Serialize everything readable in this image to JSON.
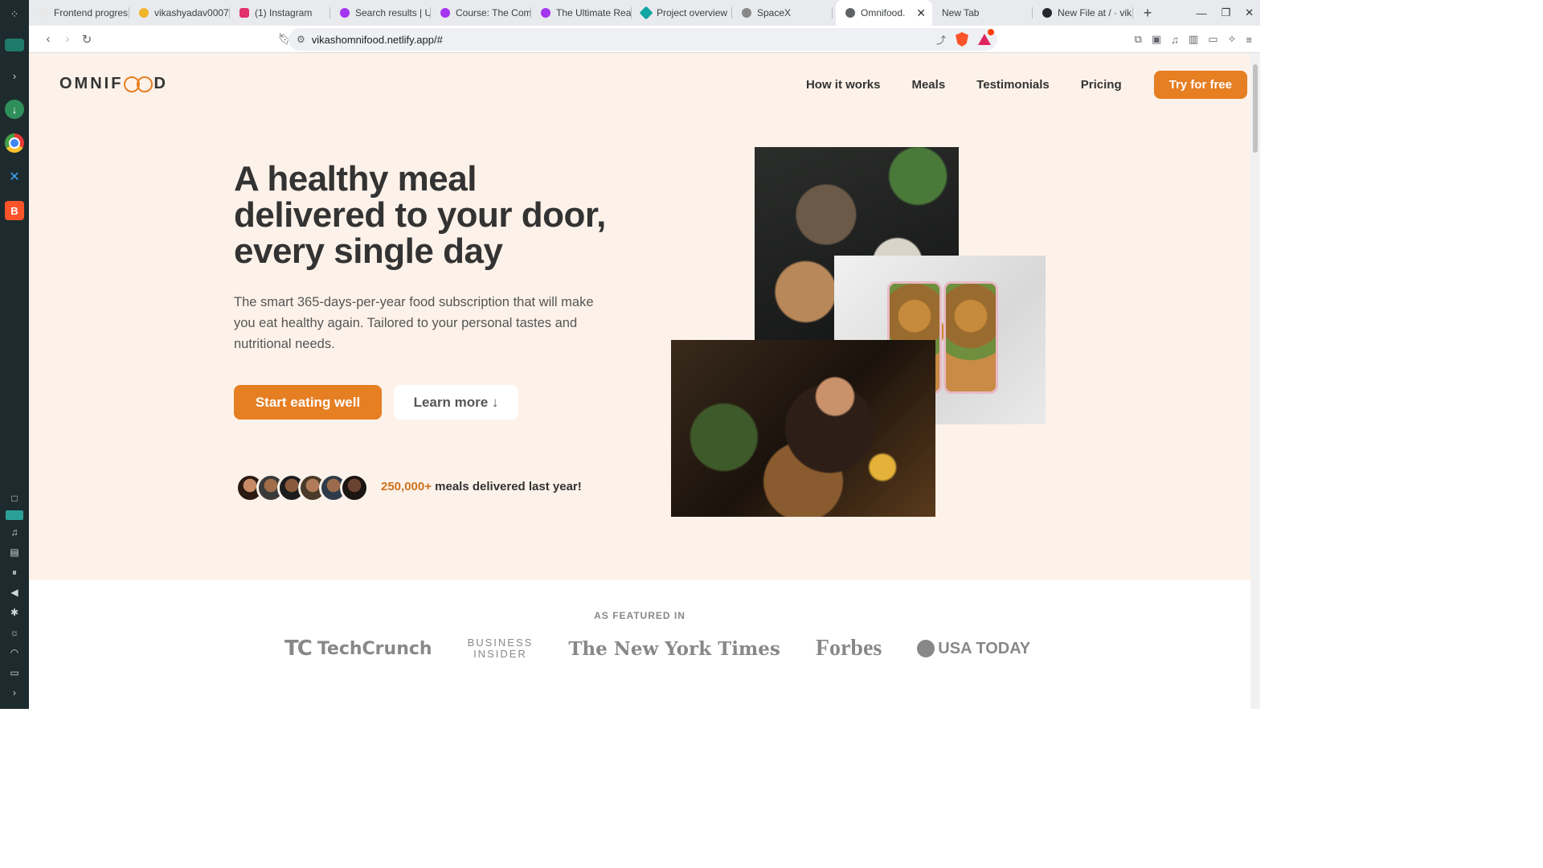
{
  "browser": {
    "tabs": [
      {
        "title": "Frontend progres",
        "favicon_color": "#e8e8e8"
      },
      {
        "title": "vikashyadav0007",
        "favicon_color": "#f0b429"
      },
      {
        "title": "(1) Instagram",
        "favicon_color": "#e1306c"
      },
      {
        "title": "Search results | U",
        "favicon_color": "#a435f0"
      },
      {
        "title": "Course: The Com",
        "favicon_color": "#a435f0"
      },
      {
        "title": "The Ultimate Rea",
        "favicon_color": "#a435f0"
      },
      {
        "title": "Project overview",
        "favicon_color": "#0fa5a0"
      },
      {
        "title": "SpaceX",
        "favicon_color": "#888888"
      }
    ],
    "active_tab": {
      "title": "Omnifood."
    },
    "after_tabs": [
      {
        "title": "New Tab"
      },
      {
        "title": "New File at / · vik"
      }
    ],
    "url": "vikashomnifood.netlify.app/#"
  },
  "site": {
    "logo_left": "OMNIF",
    "logo_right": "D",
    "nav": {
      "how_it_works": "How it works",
      "meals": "Meals",
      "testimonials": "Testimonials",
      "pricing": "Pricing",
      "cta": "Try for free"
    },
    "hero": {
      "headline": "A healthy meal delivered to your door, every single day",
      "description": "The smart 365-days-per-year food subscription that will make you eat healthy again. Tailored to your personal tastes and nutritional needs.",
      "primary_button": "Start eating well",
      "secondary_button": "Learn more ↓",
      "delivered_highlight": "250,000+",
      "delivered_text": "meals delivered last year!"
    },
    "featured": {
      "heading": "AS FEATURED IN",
      "techcrunch": "TechCrunch",
      "business_insider_line1": "BUSINESS",
      "business_insider_line2": "INSIDER",
      "nyt": "The New York Times",
      "forbes": "Forbes",
      "usatoday": "USA TODAY"
    }
  },
  "colors": {
    "accent": "#e67e22",
    "hero_bg": "#fdf2e9",
    "dock_bg": "#1e2b2e"
  }
}
